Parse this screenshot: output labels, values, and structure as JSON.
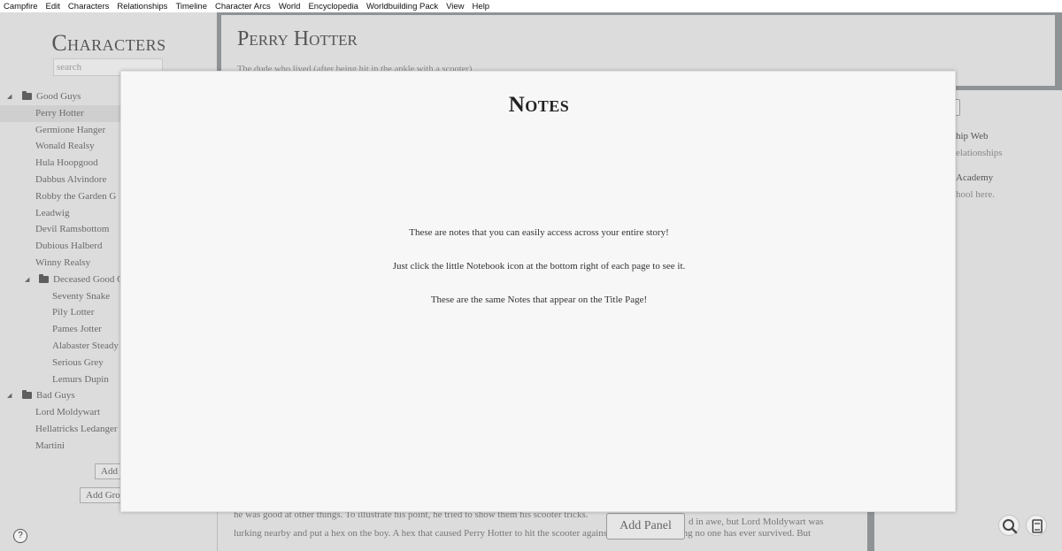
{
  "menubar": [
    "Campfire",
    "Edit",
    "Characters",
    "Relationships",
    "Timeline",
    "Character Arcs",
    "World",
    "Encyclopedia",
    "Worldbuilding Pack",
    "View",
    "Help"
  ],
  "sidebar": {
    "title": "Characters",
    "search_placeholder": "search",
    "groups": {
      "good_guys": "Good Guys",
      "deceased": "Deceased Good G",
      "bad_guys": "Bad Guys"
    },
    "good_guys": [
      "Perry Hotter",
      "Germione Hanger",
      "Wonald Realsy",
      "Hula Hoopgood",
      "Dabbus Alvindore",
      "Robby the Garden G",
      "Leadwig",
      "Devil Ramsbottom",
      "Dubious Halberd",
      "Winny Realsy"
    ],
    "deceased": [
      "Seventy Snake",
      "Pily Lotter",
      "Pames Jotter",
      "Alabaster Steady",
      "Serious Grey",
      "Lemurs Dupin"
    ],
    "bad_guys": [
      "Lord Moldywart",
      "Hellatricks Ledanger",
      "Martini"
    ],
    "add_label": "Add",
    "add_group_label": "Add Gro",
    "help_label": "?"
  },
  "main": {
    "name": "Perry Hotter",
    "description": "The dude who lived (after being hit in the ankle with a scooter)",
    "body_lines": [
      "he was good at other things. To illustrate his point, he tried to show them his scooter tricks.",
      "lurking nearby and put a hex on the boy. A hex that caused Perry Hotter to hit the scooter against his ankle, something no one has ever survived. But"
    ],
    "body_fragment": "d in awe, but Lord Moldywart was",
    "add_panel_label": "Add Panel"
  },
  "right_panel": {
    "item1_title": "hip Web",
    "item1_sub": "elationships",
    "item2_title": "Academy",
    "item2_sub": "hool here."
  },
  "modal": {
    "title": "Notes",
    "lines": [
      "These are notes that you can easily access across your entire story!",
      "Just click the little Notebook icon at the bottom right of each page to see it.",
      "These are the same Notes that appear on the Title Page!"
    ]
  },
  "icons": {
    "search": "magnifier-icon",
    "notebook": "notebook-icon",
    "folder": "folder-icon"
  }
}
